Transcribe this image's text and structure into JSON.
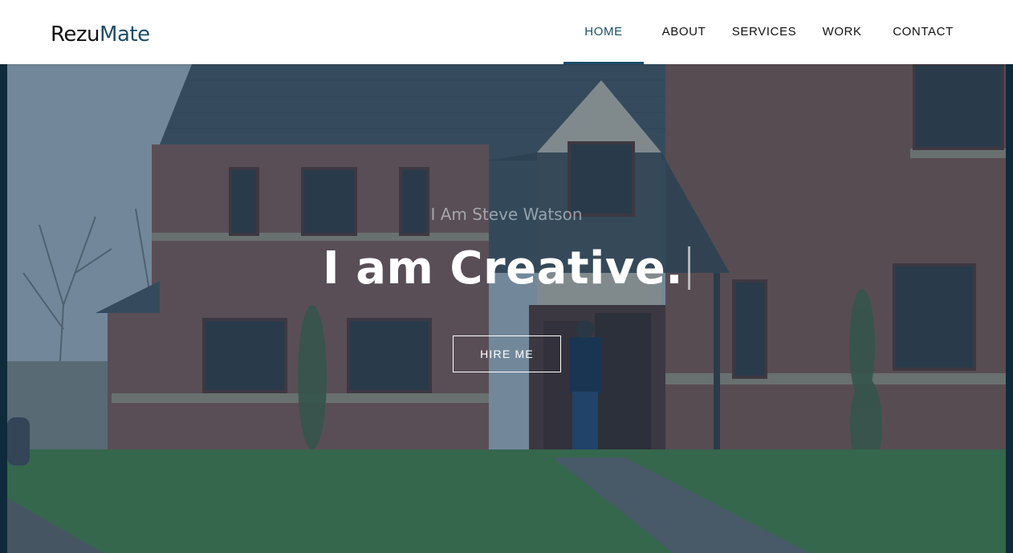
{
  "header": {
    "logo_part1": "Rezu",
    "logo_part2": "Mate",
    "nav": [
      {
        "label": "HOME",
        "active": true
      },
      {
        "label": "ABOUT",
        "active": false
      },
      {
        "label": "SERVICES",
        "active": false
      },
      {
        "label": "WORK",
        "active": false
      },
      {
        "label": "CONTACT",
        "active": false
      }
    ]
  },
  "hero": {
    "intro": "I Am Steve Watson",
    "headline": "I am Creative.",
    "button_label": "HIRE ME"
  },
  "colors": {
    "accent": "#1c4e6a",
    "overlay": "#143755"
  }
}
